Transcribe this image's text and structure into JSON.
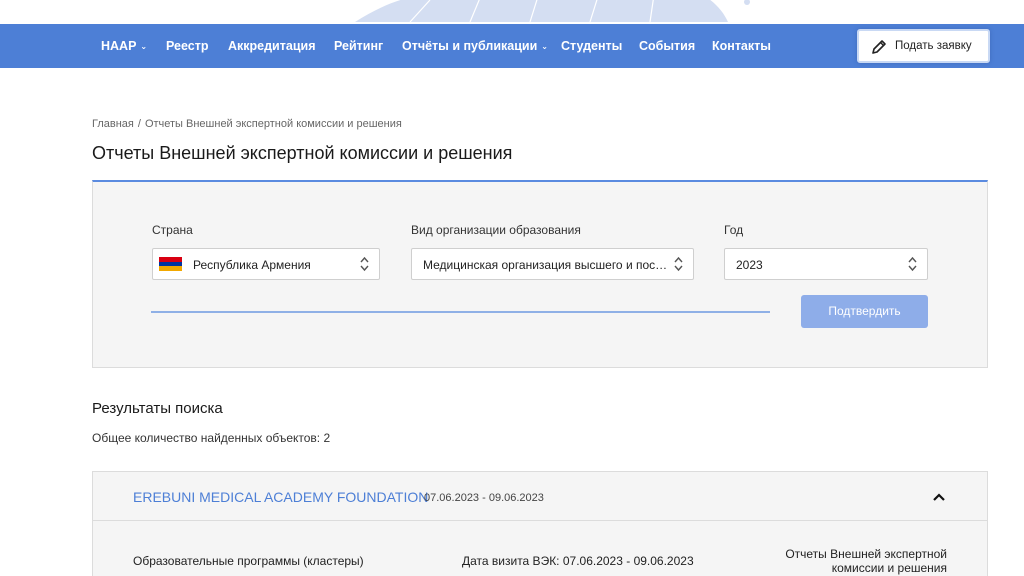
{
  "nav": {
    "items": [
      {
        "label": "НААР",
        "has_dropdown": true
      },
      {
        "label": "Реестр",
        "has_dropdown": false
      },
      {
        "label": "Аккредитация",
        "has_dropdown": false
      },
      {
        "label": "Рейтинг",
        "has_dropdown": false
      },
      {
        "label": "Отчёты и публикации",
        "has_dropdown": true
      },
      {
        "label": "Студенты",
        "has_dropdown": false
      },
      {
        "label": "События",
        "has_dropdown": false
      },
      {
        "label": "Контакты",
        "has_dropdown": false
      }
    ],
    "chevron": "⌄",
    "apply_label": "Подать заявку",
    "apply_icon": "pencil-icon",
    "bg_color": "#4d7fd6"
  },
  "breadcrumb": {
    "home": "Главная",
    "separator": "/",
    "current": "Отчеты Внешней экспертной комиссии и решения"
  },
  "page_title": "Отчеты Внешней экспертной комиссии и решения",
  "filters": {
    "country": {
      "label": "Страна",
      "value": "Республика Армения",
      "flag": "armenia-flag"
    },
    "org_type": {
      "label": "Вид организации образования",
      "value": "Медицинская организация высшего и послевузовского образования"
    },
    "year": {
      "label": "Год",
      "value": "2023"
    },
    "submit_label": "Подтвердить",
    "accent_color": "#5b8be0"
  },
  "results": {
    "title": "Результаты поиска",
    "count_text": "Общее количество найденных объектов: 2",
    "items": [
      {
        "name": "EREBUNI MEDICAL ACADEMY FOUNDATION",
        "dates": "07.06.2023 - 09.06.2023",
        "programs_label": "Образовательные программы (кластеры)",
        "visit_label": "Дата визита ВЭК: 07.06.2023 - 09.06.2023",
        "reports_line1": "Отчеты Внешней экспертной",
        "reports_line2": "комиссии и решения",
        "expanded": true
      }
    ]
  }
}
